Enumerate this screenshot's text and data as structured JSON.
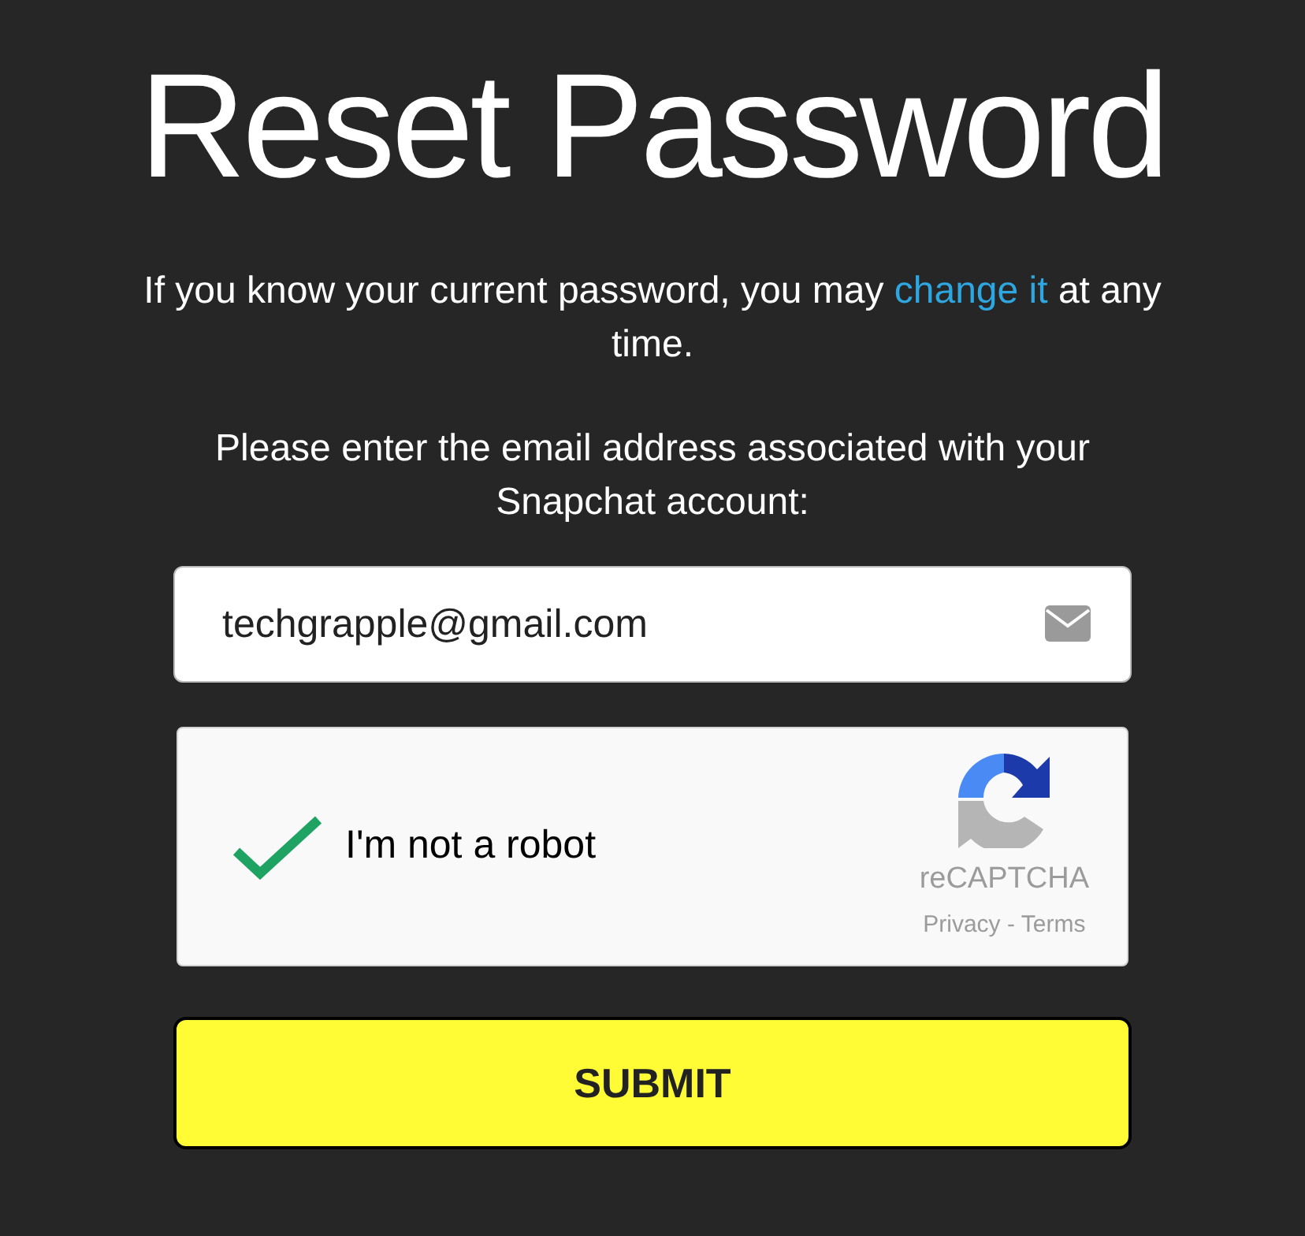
{
  "title": "Reset Password",
  "intro": {
    "before": "If you know your current password, you may ",
    "link": "change it",
    "after": " at any time."
  },
  "prompt": "Please enter the email address associated with your Snapchat account:",
  "email_field": {
    "value": "techgrapple@gmail.com"
  },
  "captcha": {
    "label": "I'm not a robot",
    "checked": true,
    "brand": "reCAPTCHA",
    "privacy": "Privacy",
    "separator": " - ",
    "terms": "Terms"
  },
  "submit": "SUBMIT"
}
